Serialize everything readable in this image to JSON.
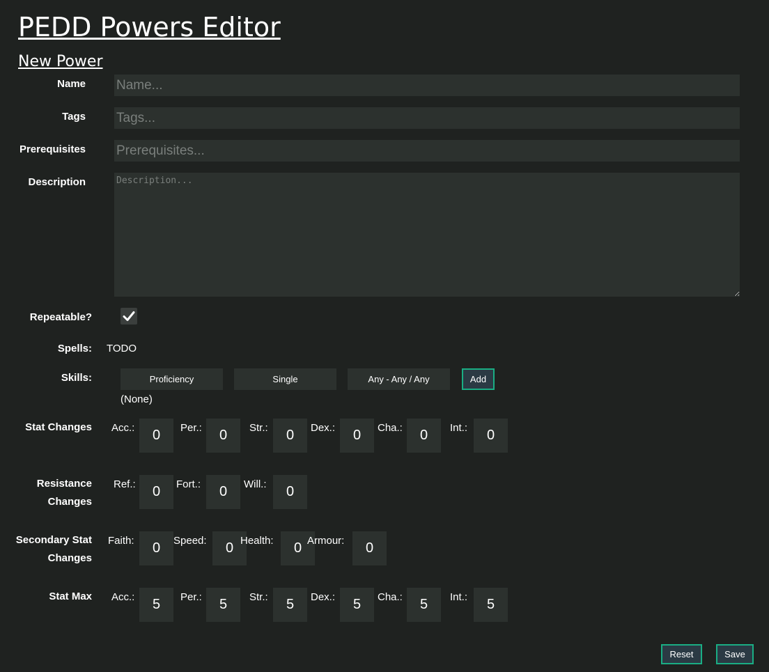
{
  "app": {
    "title": "PEDD Powers Editor",
    "subtitle": "New Power"
  },
  "form": {
    "name": {
      "label": "Name",
      "placeholder": "Name...",
      "value": ""
    },
    "tags": {
      "label": "Tags",
      "placeholder": "Tags...",
      "value": ""
    },
    "prerequisites": {
      "label": "Prerequisites",
      "placeholder": "Prerequisites...",
      "value": ""
    },
    "description": {
      "label": "Description",
      "placeholder": "Description...",
      "value": ""
    },
    "repeatable": {
      "label": "Repeatable?",
      "checked": true
    }
  },
  "spells": {
    "label": "Spells:",
    "value": "TODO"
  },
  "skills": {
    "label": "Skills:",
    "type_select": "Proficiency",
    "count_select": "Single",
    "target_select": "Any - Any / Any",
    "add_label": "Add",
    "list_text": "(None)"
  },
  "stat_changes": {
    "label": "Stat Changes",
    "items": [
      {
        "label": "Acc.:",
        "value": "0"
      },
      {
        "label": "Per.:",
        "value": "0"
      },
      {
        "label": "Str.:",
        "value": "0"
      },
      {
        "label": "Dex.:",
        "value": "0"
      },
      {
        "label": "Cha.:",
        "value": "0"
      },
      {
        "label": "Int.:",
        "value": "0"
      }
    ]
  },
  "resistance_changes": {
    "label_line1": "Resistance",
    "label_line2": "Changes",
    "items": [
      {
        "label": "Ref.:",
        "value": "0"
      },
      {
        "label": "Fort.:",
        "value": "0"
      },
      {
        "label": "Will.:",
        "value": "0"
      }
    ]
  },
  "secondary_stat_changes": {
    "label_line1": "Secondary Stat",
    "label_line2": "Changes",
    "items": [
      {
        "label": "Faith:",
        "value": "0"
      },
      {
        "label": "Speed:",
        "value": "0"
      },
      {
        "label": "Health:",
        "value": "0"
      },
      {
        "label": "Armour:",
        "value": "0"
      }
    ]
  },
  "stat_max": {
    "label": "Stat Max",
    "items": [
      {
        "label": "Acc.:",
        "value": "5"
      },
      {
        "label": "Per.:",
        "value": "5"
      },
      {
        "label": "Str.:",
        "value": "5"
      },
      {
        "label": "Dex.:",
        "value": "5"
      },
      {
        "label": "Cha.:",
        "value": "5"
      },
      {
        "label": "Int.:",
        "value": "5"
      }
    ]
  },
  "actions": {
    "reset_label": "Reset",
    "save_label": "Save"
  },
  "colors": {
    "background": "#1f2220",
    "field": "#2c312e",
    "accent_border": "#1aae84",
    "button_fill": "#2b3a44"
  }
}
